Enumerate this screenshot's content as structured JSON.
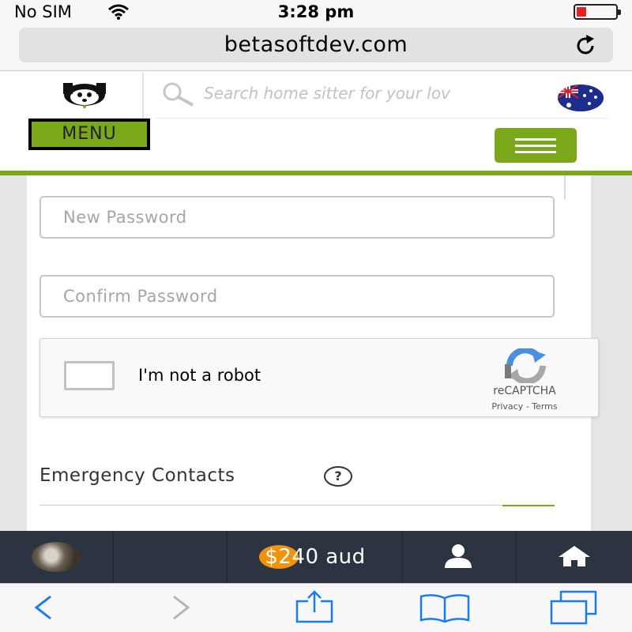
{
  "status_bar": {
    "carrier": "No SIM",
    "time": "3:28 pm"
  },
  "browser": {
    "url": "betasoftdev.com"
  },
  "header": {
    "search_placeholder": "Search home sitter for your lov",
    "menu_label": "MENU",
    "accent_color": "#7aa81a"
  },
  "form": {
    "new_password_placeholder": "New Password",
    "confirm_password_placeholder": "Confirm Password",
    "recaptcha": {
      "label": "I'm not a robot",
      "brand": "reCAPTCHA",
      "links": "Privacy - Terms"
    },
    "section_title": "Emergency Contacts",
    "help_glyph": "?"
  },
  "app_bar": {
    "balance": "$240 aud",
    "status_color": "#f0930a"
  },
  "safari_toolbar": {
    "icons": [
      "back-icon",
      "forward-icon",
      "share-icon",
      "bookmarks-icon",
      "tabs-icon"
    ]
  }
}
